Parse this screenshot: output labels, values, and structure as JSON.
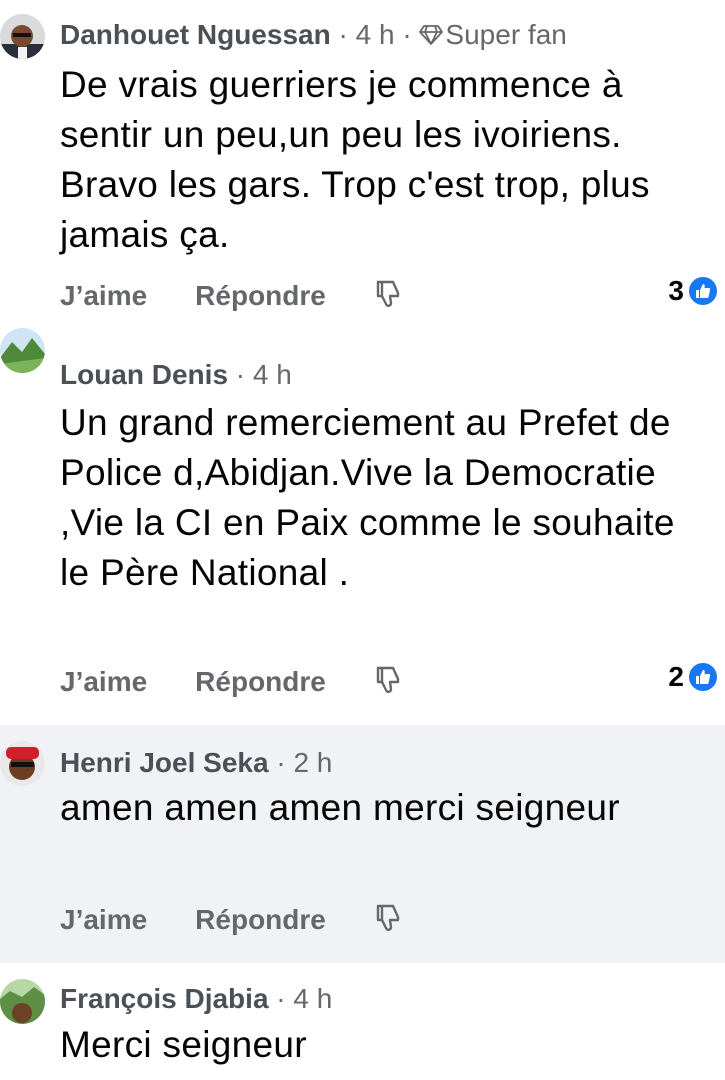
{
  "actions": {
    "like_label": "J’aime",
    "reply_label": "Répondre"
  },
  "comments": [
    {
      "author": "Danhouet Nguessan",
      "time": "4 h",
      "badge": "Super fan",
      "text": "De vrais guerriers je commence à sentir un peu,un peu les ivoiriens. Bravo les gars. Trop c'est trop, plus jamais ça.",
      "reactions": "3"
    },
    {
      "author": "Louan Denis",
      "time": "4 h",
      "text": "Un grand remerciement au Prefet de Police d,Abidjan.Vive la Democratie ,Vie la CI en Paix comme le souhaite le Père National .",
      "reactions": "2"
    },
    {
      "author": "Henri Joel Seka",
      "time": "2 h",
      "text": "amen amen amen merci seigneur"
    },
    {
      "author": "François Djabia",
      "time": "4 h",
      "text": "Merci seigneur"
    }
  ],
  "colors": {
    "accent": "#1877f2",
    "highlight_bg": "#f0f2f5",
    "secondary_text": "#65676b"
  }
}
